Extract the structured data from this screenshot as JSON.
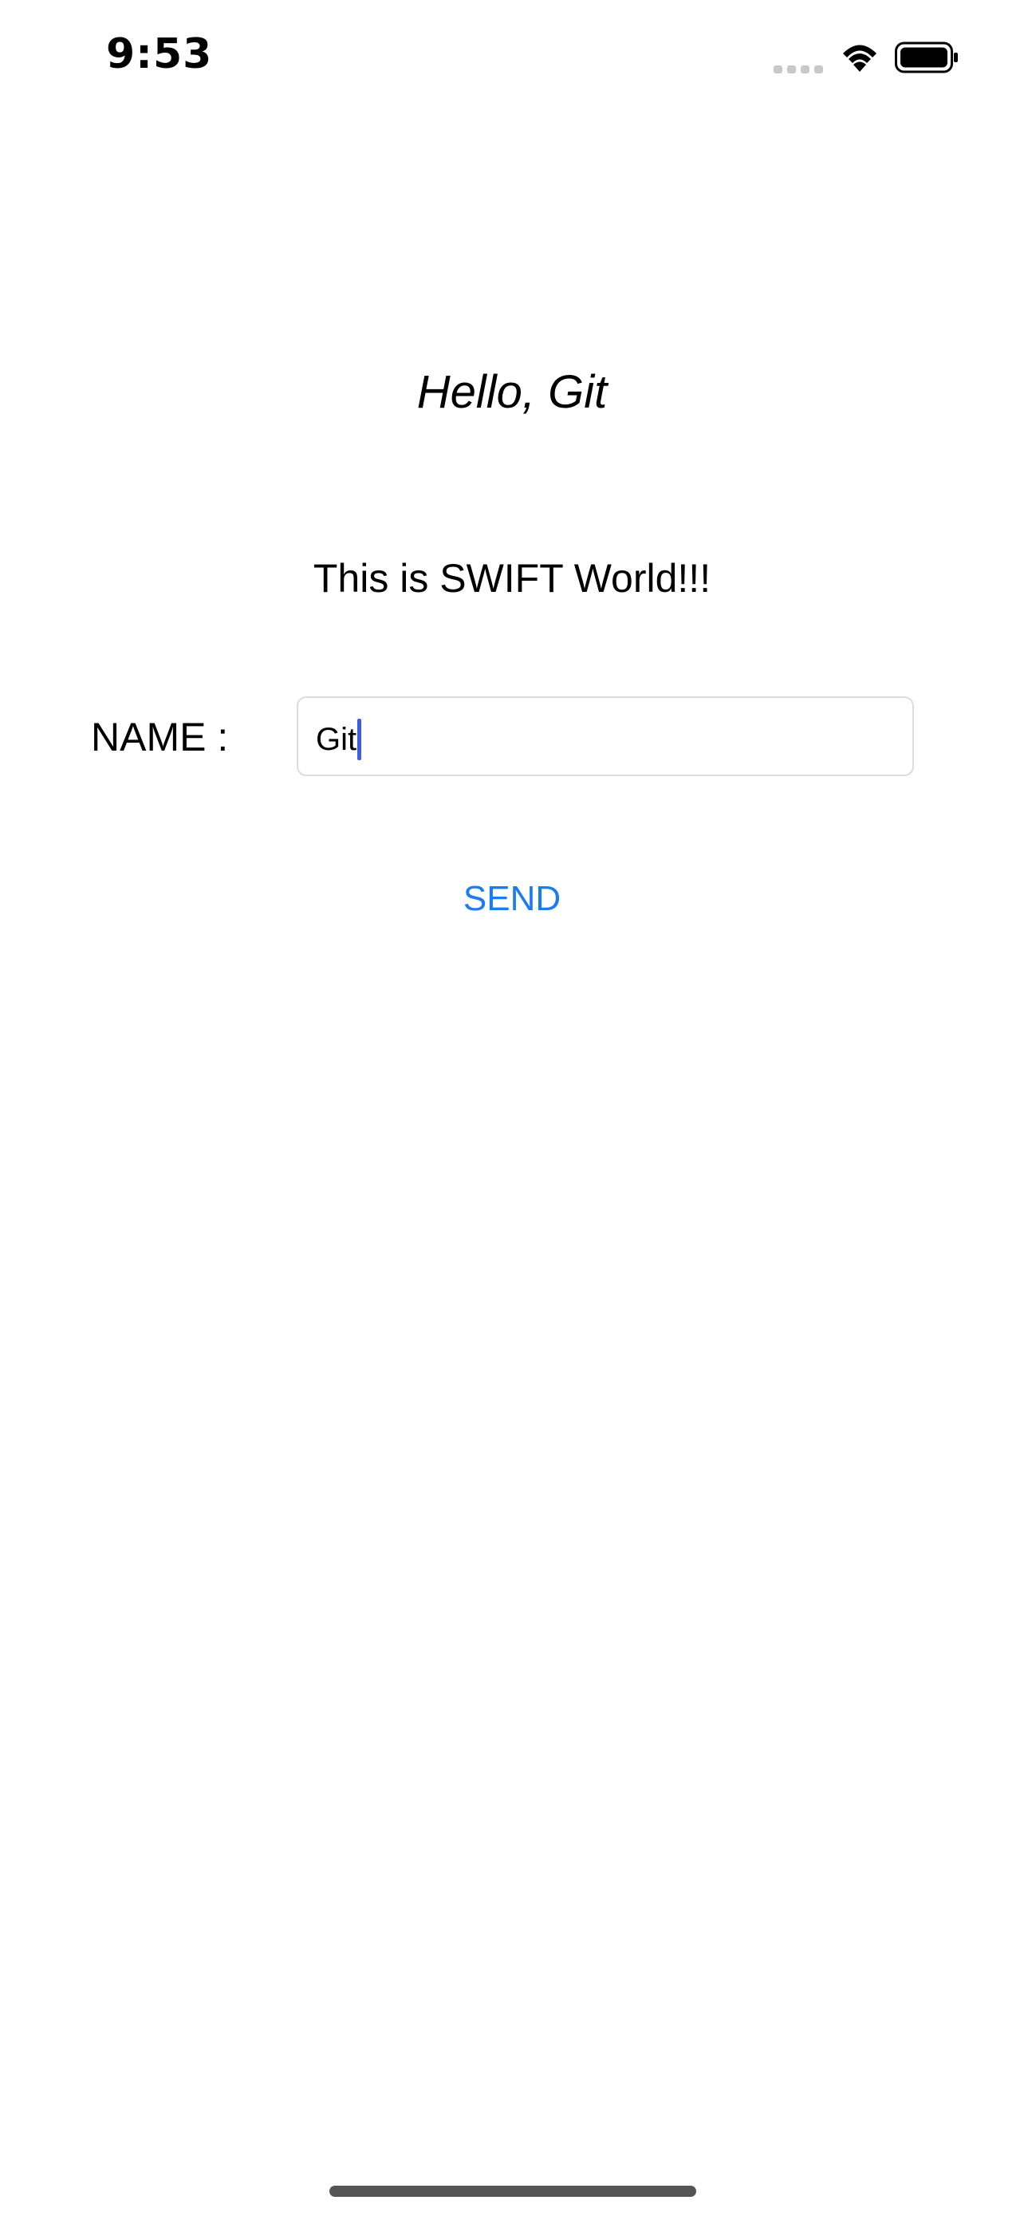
{
  "status_bar": {
    "time": "9:53",
    "icons": [
      "cellular-signal-icon",
      "wifi-icon",
      "battery-icon"
    ]
  },
  "main": {
    "greeting": "Hello, Git",
    "subtitle": "This is SWIFT World!!!",
    "name_label": "NAME :",
    "name_value": "Git",
    "send_label": "SEND"
  },
  "colors": {
    "accent": "#1a7cf0",
    "caret": "#3d5ee0",
    "field_border": "#dcdcdc"
  }
}
